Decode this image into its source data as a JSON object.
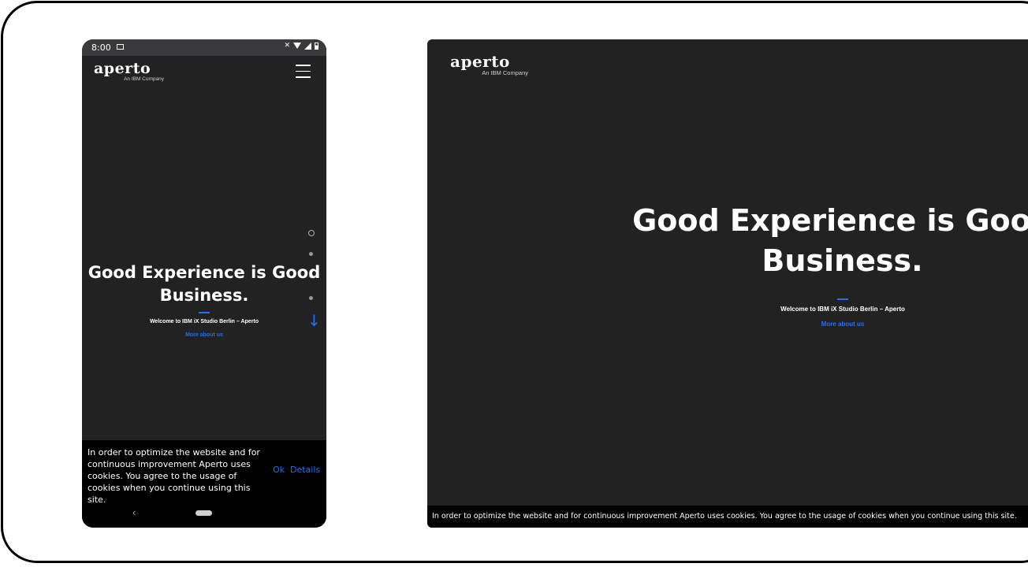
{
  "phone": {
    "status": {
      "time": "8:00"
    },
    "logo": {
      "name": "aperto",
      "tagline": "An IBM Company"
    },
    "hero": {
      "title": "Good Experience is Good Business.",
      "subtitle": "Welcome to IBM iX Studio Berlin – Aperto",
      "link": "More about us"
    },
    "cookie": {
      "text": "In order to optimize the website and for continuous improvement Aperto uses cookies. You agree to the usage of cookies when you continue using this site.",
      "ok_label": "Ok",
      "details_label": "Details"
    },
    "nav": {
      "back": "‹"
    }
  },
  "desktop": {
    "logo": {
      "name": "aperto",
      "tagline": "An IBM Company"
    },
    "hero": {
      "title_line1": "Good Experience is Good",
      "title_line2": "Business.",
      "subtitle": "Welcome to IBM iX Studio Berlin – Aperto",
      "link": "More about us"
    },
    "cookie": {
      "text": "In order to optimize the website and for continuous improvement Aperto uses cookies. You agree to the usage of cookies when you continue using this site."
    }
  },
  "colors": {
    "accent": "#1f70ff",
    "background": "#222223",
    "cookie_bar": "#000000"
  },
  "icons": [
    "mail-icon",
    "mute-icon",
    "wifi-icon",
    "signal-icon",
    "battery-icon",
    "hamburger-menu-icon",
    "scroll-down-arrow-icon",
    "home-pill-icon",
    "back-icon"
  ]
}
